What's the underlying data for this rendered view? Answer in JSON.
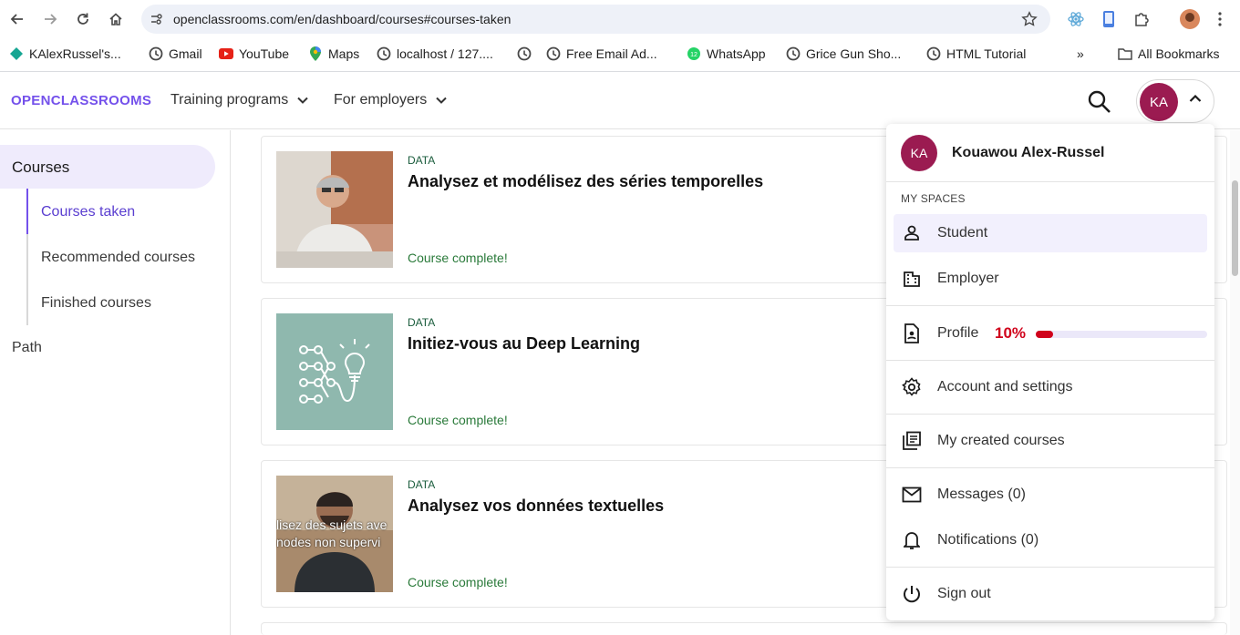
{
  "browser": {
    "url": "openclassrooms.com/en/dashboard/courses#courses-taken",
    "bookmarks": [
      {
        "label": "KAlexRussel's...",
        "icon": "diamond-icon"
      },
      {
        "label": "Gmail",
        "icon": "globe-icon"
      },
      {
        "label": "YouTube",
        "icon": "youtube-icon"
      },
      {
        "label": "Maps",
        "icon": "maps-pin-icon"
      },
      {
        "label": "localhost / 127....",
        "icon": "globe-icon"
      },
      {
        "label": "",
        "icon": "globe-icon"
      },
      {
        "label": "Free Email Ad...",
        "icon": "globe-icon"
      },
      {
        "label": "WhatsApp",
        "icon": "whatsapp-icon"
      },
      {
        "label": "Grice Gun Sho...",
        "icon": "globe-icon"
      },
      {
        "label": "HTML Tutorial",
        "icon": "globe-icon"
      }
    ],
    "overflow": "»",
    "all_bookmarks": "All Bookmarks"
  },
  "header": {
    "logo": "OPENCLASSROOMS",
    "nav": [
      "Training programs",
      "For employers"
    ],
    "user_initials": "KA"
  },
  "sidebar": {
    "courses": "Courses",
    "items": [
      "Courses taken",
      "Recommended courses",
      "Finished courses"
    ],
    "path": "Path"
  },
  "courses": [
    {
      "category": "DATA",
      "title": "Analysez et modélisez des séries temporelles",
      "status": "Course complete!"
    },
    {
      "category": "DATA",
      "title": "Initiez-vous au Deep Learning",
      "status": "Course complete!"
    },
    {
      "category": "DATA",
      "title": "Analysez vos données textuelles",
      "status": "Course complete!",
      "thumb_text": [
        "lisez des sujets ave",
        "nodes non supervi"
      ]
    }
  ],
  "dropdown": {
    "initials": "KA",
    "name": "Kouawou Alex-Russel",
    "spaces_label": "MY SPACES",
    "student": "Student",
    "employer": "Employer",
    "profile": "Profile",
    "profile_pct": "10%",
    "profile_progress": 0.1,
    "account": "Account and settings",
    "created": "My created courses",
    "messages": "Messages (0)",
    "notifications": "Notifications (0)",
    "signout": "Sign out"
  },
  "colors": {
    "brand": "#7451eb",
    "avatar": "#9b1b51",
    "complete": "#2a7a3a",
    "progress": "#d0021b"
  }
}
